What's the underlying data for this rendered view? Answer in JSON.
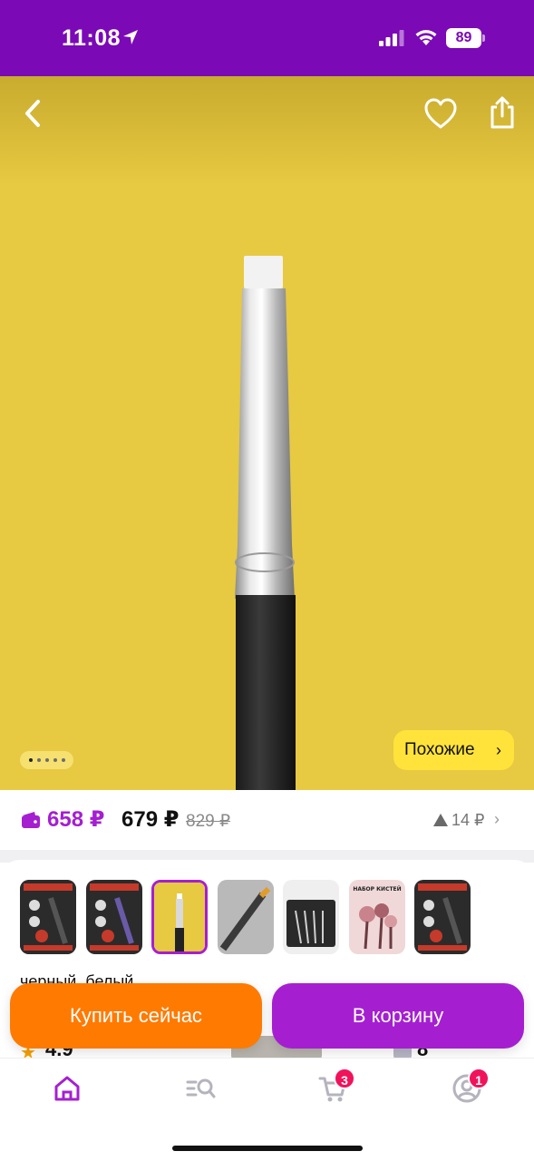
{
  "status_bar": {
    "time": "11:08",
    "battery": "89",
    "icons": [
      "location-arrow-icon",
      "signal-icon",
      "wifi-icon",
      "battery-icon"
    ]
  },
  "hero": {
    "background_color": "#e7c942",
    "back_icon": "chevron-left-icon",
    "favorite_icon": "heart-icon",
    "share_icon": "share-icon",
    "page_indicator": {
      "count": 5,
      "active": 0
    },
    "similar_label": "Похожие",
    "similar_chevron": "›"
  },
  "price": {
    "card_price": "658 ₽",
    "regular_price": "679 ₽",
    "old_price": "829 ₽",
    "delta": "14 ₽",
    "delta_chevron": "›",
    "card_color": "#a51fd1"
  },
  "variants": {
    "thumbnails": [
      {
        "name": "variant-black-set"
      },
      {
        "name": "variant-black-set-2"
      },
      {
        "name": "variant-yellow-brush",
        "selected": true
      },
      {
        "name": "variant-gray-brush"
      },
      {
        "name": "variant-brush-box"
      },
      {
        "name": "variant-pink-set",
        "text": "НАБОР КИСТЕЙ"
      },
      {
        "name": "variant-black-set-3"
      }
    ],
    "color_label": "черный, белый"
  },
  "peek": {
    "rating": "4.9",
    "star": "★",
    "reviews": "8"
  },
  "actions": {
    "buy_now": "Купить сейчас",
    "add_to_cart": "В корзину",
    "buy_color": "#ff7a00",
    "cart_color": "#a51fd1"
  },
  "bottom_nav": {
    "items": [
      {
        "name": "home",
        "icon": "home-icon"
      },
      {
        "name": "catalog",
        "icon": "catalog-search-icon"
      },
      {
        "name": "cart",
        "icon": "cart-icon",
        "badge": "3"
      },
      {
        "name": "profile",
        "icon": "profile-icon",
        "badge": "1"
      }
    ],
    "active_color": "#a51fd1"
  }
}
